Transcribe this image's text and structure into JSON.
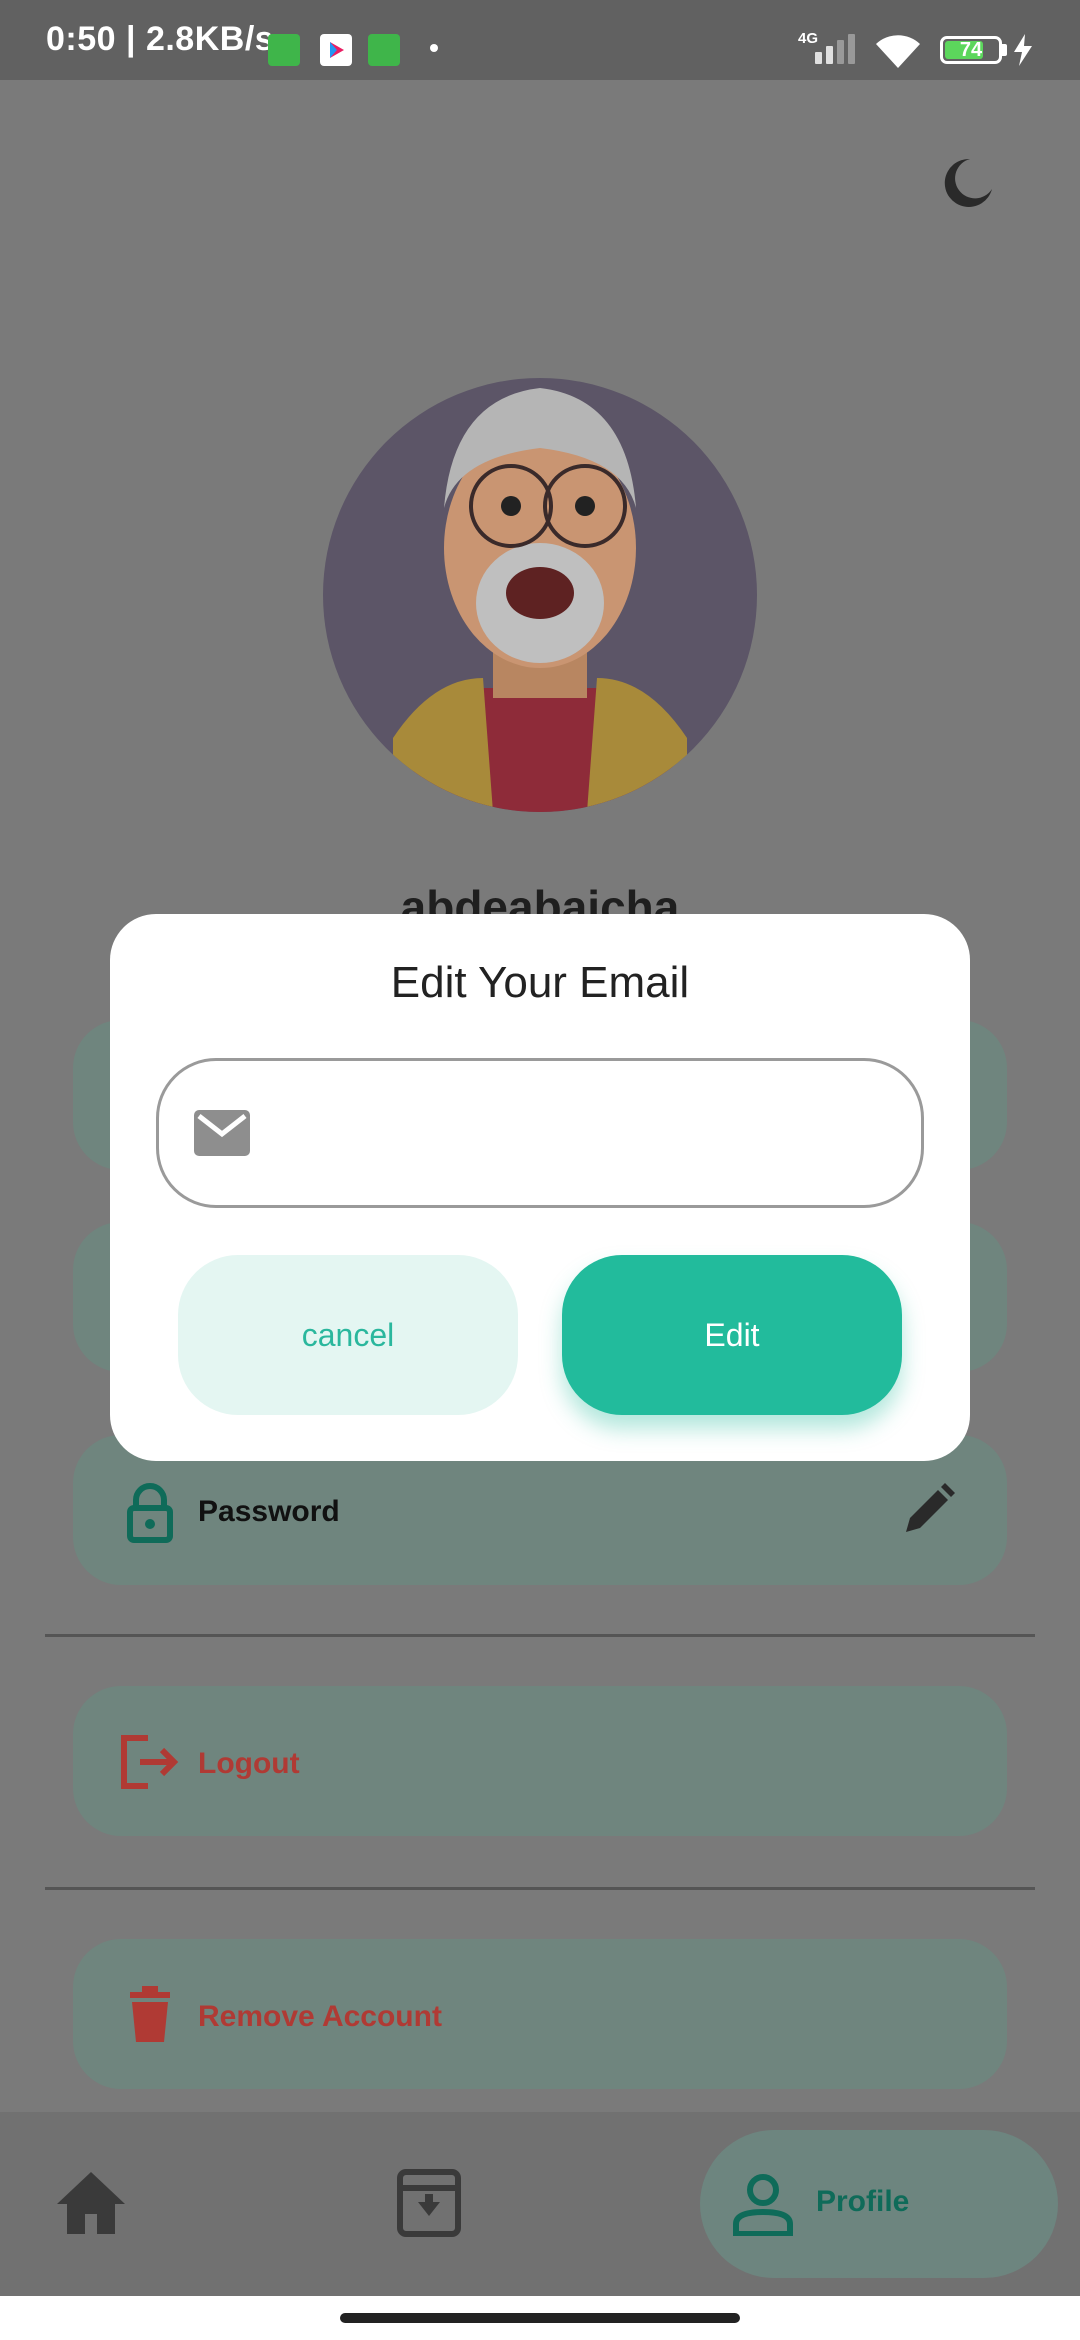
{
  "status_bar": {
    "time": "0:50 | 2.8KB/s",
    "network": "4G",
    "battery": "74",
    "battery_level": 0.74
  },
  "profile": {
    "username": "abdeabaicha"
  },
  "menu": {
    "password_label": "Password",
    "logout_label": "Logout",
    "remove_account_label": "Remove Account"
  },
  "bottom_nav": {
    "profile_label": "Profile"
  },
  "dialog": {
    "title": "Edit Your Email",
    "email_value": "",
    "cancel_label": "cancel",
    "edit_label": "Edit"
  },
  "colors": {
    "accent": "#22bb9c",
    "accent_light": "#e4f6f2",
    "danger": "#b03a34"
  }
}
